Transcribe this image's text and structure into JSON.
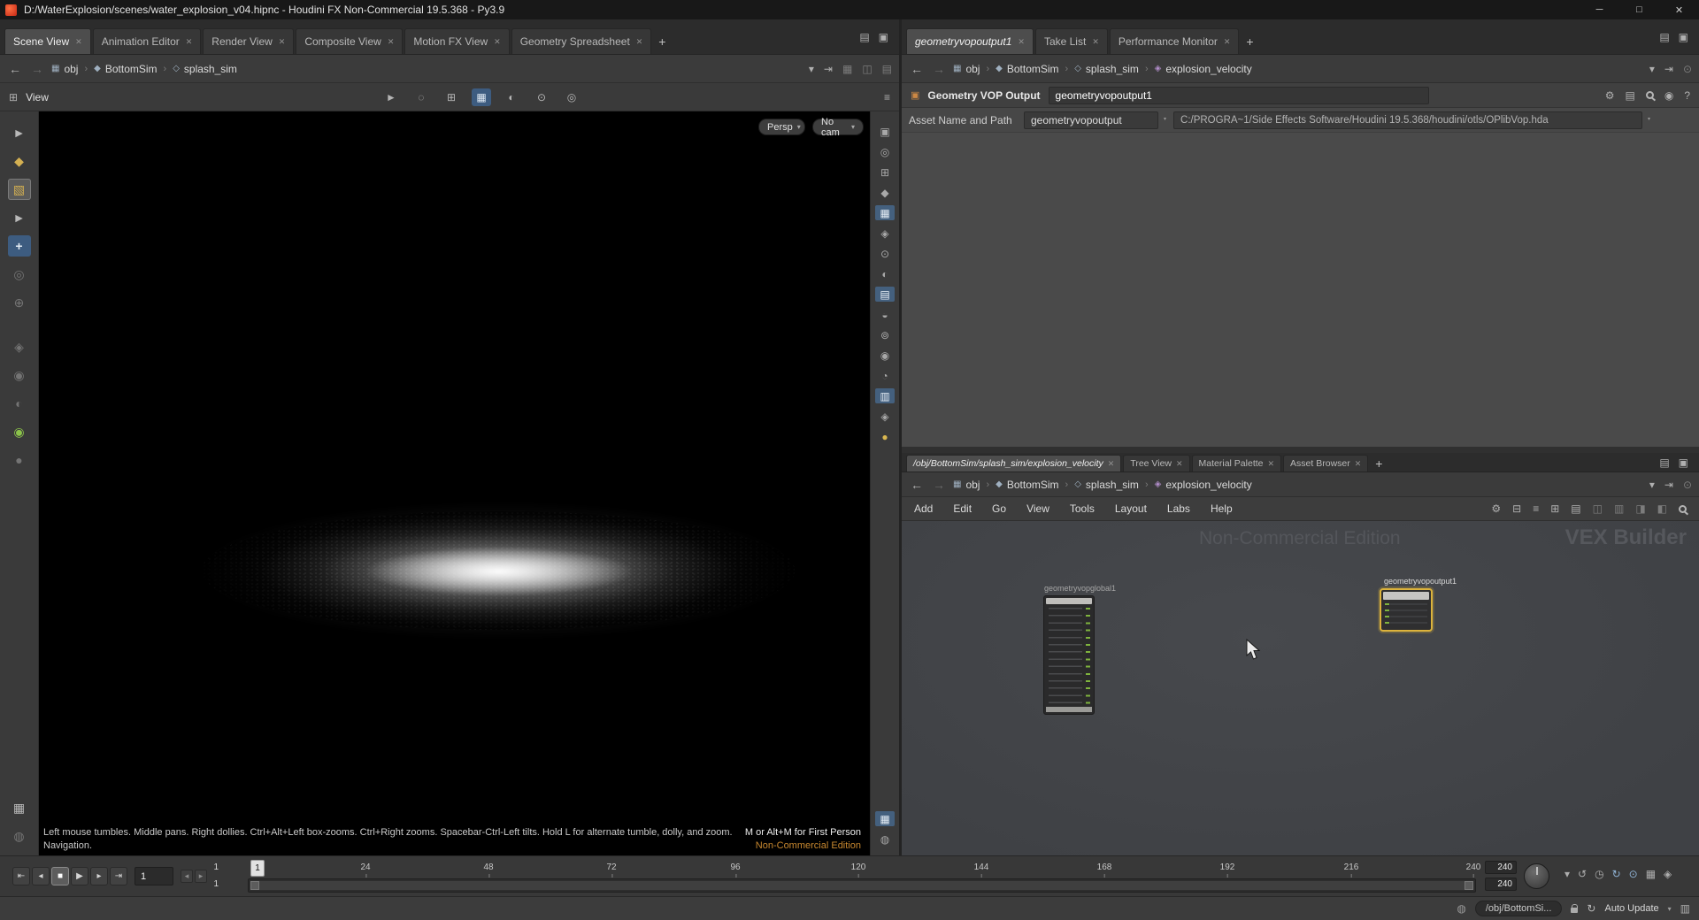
{
  "window": {
    "title": "D:/WaterExplosion/scenes/water_explosion_v04.hipnc - Houdini FX Non-Commercial 19.5.368 - Py3.9"
  },
  "left_pane": {
    "tabs": [
      {
        "label": "Scene View"
      },
      {
        "label": "Animation Editor"
      },
      {
        "label": "Render View"
      },
      {
        "label": "Composite View"
      },
      {
        "label": "Motion FX View"
      },
      {
        "label": "Geometry Spreadsheet"
      }
    ],
    "breadcrumb": [
      "obj",
      "BottomSim",
      "splash_sim"
    ],
    "viewbar_label": "View",
    "viewport": {
      "persp": "Persp",
      "cam": "No cam",
      "help_line1": "Left mouse tumbles. Middle pans. Right dollies. Ctrl+Alt+Left box-zooms. Ctrl+Right zooms. Spacebar-Ctrl-Left tilts. Hold L for alternate tumble, dolly, and zoom.",
      "help_line2": "Navigation.",
      "first_person_hint": "M or Alt+M for First Person",
      "edition": "Non-Commercial Edition"
    }
  },
  "param_pane": {
    "tabs": [
      {
        "label": "geometryvopoutput1"
      },
      {
        "label": "Take List"
      },
      {
        "label": "Performance Monitor"
      }
    ],
    "breadcrumb": [
      "obj",
      "BottomSim",
      "splash_sim",
      "explosion_velocity"
    ],
    "type_label": "Geometry VOP Output",
    "node_name": "geometryvopoutput1",
    "asset_label": "Asset Name and Path",
    "asset_name": "geometryvopoutput",
    "asset_path": "C:/PROGRA~1/Side Effects Software/Houdini 19.5.368/houdini/otls/OPlibVop.hda"
  },
  "network_pane": {
    "tabs": [
      {
        "label": "/obj/BottomSim/splash_sim/explosion_velocity"
      },
      {
        "label": "Tree View"
      },
      {
        "label": "Material Palette"
      },
      {
        "label": "Asset Browser"
      }
    ],
    "breadcrumb": [
      "obj",
      "BottomSim",
      "splash_sim",
      "explosion_velocity"
    ],
    "menus": [
      "Add",
      "Edit",
      "Go",
      "View",
      "Tools",
      "Layout",
      "Labs",
      "Help"
    ],
    "watermark_left": "Non-Commercial Edition",
    "watermark_right": "VEX Builder",
    "nodes": [
      {
        "label": "geometryvopglobal1"
      },
      {
        "label": "geometryvopoutput1"
      }
    ]
  },
  "playbar": {
    "current_frame": "1",
    "range_start_top": "1",
    "range_start_bottom": "1",
    "playhead": "1",
    "ticks": [
      "24",
      "48",
      "72",
      "96",
      "120",
      "144",
      "168",
      "192",
      "216",
      "240"
    ],
    "range_end_top": "240",
    "range_end_bottom": "240"
  },
  "status_bar": {
    "network_path": "/obj/BottomSi...",
    "auto_update_label": "Auto Update"
  },
  "icons": {
    "minimize": "─",
    "maximize": "□",
    "close": "✕",
    "back": "←",
    "forward": "→",
    "dropdown": "▾",
    "crumb_sep": "›",
    "pin": "⊙",
    "jump": "⇥",
    "tab_close": "✕",
    "tab_add": "+",
    "pane_menu": "▤",
    "pane_float": "▣",
    "to_start": "⇤",
    "step_back": "◂",
    "stop": "■",
    "play": "▶",
    "step_fwd": "▸",
    "to_end": "⇥",
    "prev_key": "◂",
    "next_key": "▸",
    "obj_icon": "▦",
    "geo_icon": "◆",
    "sim_icon": "◇",
    "vop_icon": "◈",
    "gear": "⚙",
    "book": "▤",
    "info": "?",
    "round": "◉",
    "grid": "⊞",
    "list": "≡",
    "minus_box": "⊟",
    "col1": "◫",
    "col2": "▥",
    "col3": "◨",
    "col4": "◧",
    "select": "►",
    "lasso": "◌",
    "snap": "▦",
    "shade": "◐",
    "light": "⊙",
    "cam": "◎",
    "sliders": "≡",
    "undo": "↺",
    "clock": "◷",
    "redo": "↻",
    "dot": "⊙",
    "film": "▦",
    "diam": "◈",
    "sphere": "◍",
    "node_type": "▣"
  },
  "left_tools": [
    {
      "glyph": "►"
    },
    {
      "glyph": "◆"
    },
    {
      "glyph": "▧"
    },
    {
      "glyph": "►"
    },
    {
      "glyph": "+"
    },
    {
      "glyph": "◎"
    },
    {
      "glyph": "⊕"
    },
    {
      "glyph": "◈"
    },
    {
      "glyph": "◉"
    },
    {
      "glyph": "◐"
    },
    {
      "glyph": "◉"
    },
    {
      "glyph": "●"
    },
    {
      "glyph": "▦"
    },
    {
      "glyph": "◍"
    }
  ],
  "right_strip": [
    {
      "glyph": "▣"
    },
    {
      "glyph": "◎"
    },
    {
      "glyph": "⊞"
    },
    {
      "glyph": "◆"
    },
    {
      "glyph": "▦"
    },
    {
      "glyph": "◈"
    },
    {
      "glyph": "⊙"
    },
    {
      "glyph": "◐"
    },
    {
      "glyph": "▤"
    },
    {
      "glyph": "◒"
    },
    {
      "glyph": "⊚"
    },
    {
      "glyph": "◉"
    },
    {
      "glyph": "◔"
    },
    {
      "glyph": "▥"
    },
    {
      "glyph": "◈"
    },
    {
      "glyph": "●"
    },
    {
      "glyph": "▦"
    },
    {
      "glyph": "◍"
    }
  ]
}
